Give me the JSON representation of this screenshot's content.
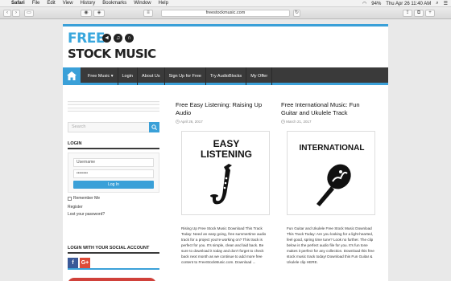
{
  "menubar": {
    "app_name": "Safari",
    "items": [
      "File",
      "Edit",
      "View",
      "History",
      "Bookmarks",
      "Window",
      "Help"
    ],
    "battery": "94%",
    "datetime": "Thu Apr 26  11:40 AM"
  },
  "browser": {
    "url": "freestockmusic.com"
  },
  "site": {
    "logo_free": "FREE",
    "logo_stock": "STOCK MUSIC",
    "nav": [
      "Free Music",
      "Login",
      "About Us",
      "Sign Up for Free",
      "Try AudioBlocks",
      "My Offer"
    ],
    "nav_dropdown_mark": "▾"
  },
  "sidebar": {
    "search_placeholder": "Search",
    "login_title": "LOGIN",
    "username_label": "Username",
    "password_value": "••••••••",
    "login_button": "Log In",
    "remember_label": "Remember Me",
    "register_link": "Register",
    "lost_password_link": "Lost your password?",
    "social_title": "LOGIN WITH YOUR SOCIAL ACCOUNT",
    "social_icons": [
      "facebook-icon",
      "google-plus-icon"
    ],
    "social_labels": {
      "facebook": "f",
      "google": "G+"
    }
  },
  "posts": [
    {
      "title": "Free Easy Listening: Raising Up Audio",
      "date": "April 26, 2017",
      "thumb_text": [
        "EASY",
        "LISTENING"
      ],
      "excerpt": "Rising Up Free Stock Music Download This Track Today: Need an easy going, free summertime audio track for a project you're working on? This track is perfect for you. It's simple, clean and laid back. Be sure to download it today and don't forget to check back next month as we continue to add more free content to FreeStockMusic.com. Download ..."
    },
    {
      "title": "Free International Music: Fun Guitar and Ukulele Track",
      "date": "March 21, 2017",
      "thumb_text": [
        "INTERNATIONAL"
      ],
      "excerpt": "Fun Guitar and Ukulele Free Stock Music Download This Track Today: Are you looking for a light-hearted, feel good, spring time tune? Look no further. The clip below is the perfect audio file for you. It's fun tone makes it perfect for any collection. Download this free stock music track today! Download this Fun Guitar & Ukulele clip HERE."
    }
  ],
  "colors": {
    "accent": "#3aa0d8",
    "nav_bg": "#3a3a3a",
    "facebook": "#3b5998",
    "google": "#dd4b39"
  }
}
